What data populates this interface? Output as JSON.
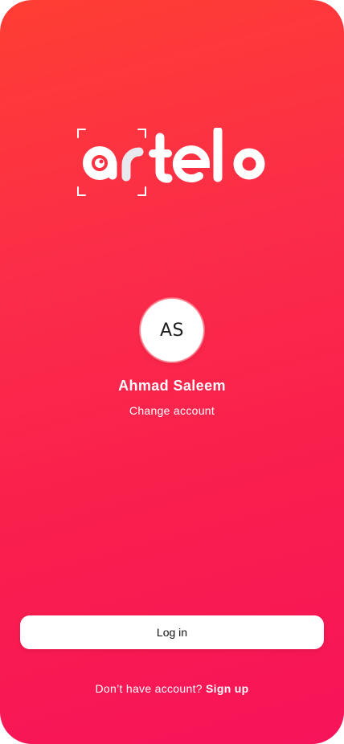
{
  "brand": {
    "logo_text": "artelo",
    "background_gradient": [
      "#ff3e33",
      "#f7135a"
    ]
  },
  "profile": {
    "initials": "AS",
    "name": "Ahmad Saleem",
    "change_account_label": "Change account"
  },
  "actions": {
    "login_label": "Log in",
    "signup_prompt": "Don’t have account?",
    "signup_label": "Sign up"
  }
}
